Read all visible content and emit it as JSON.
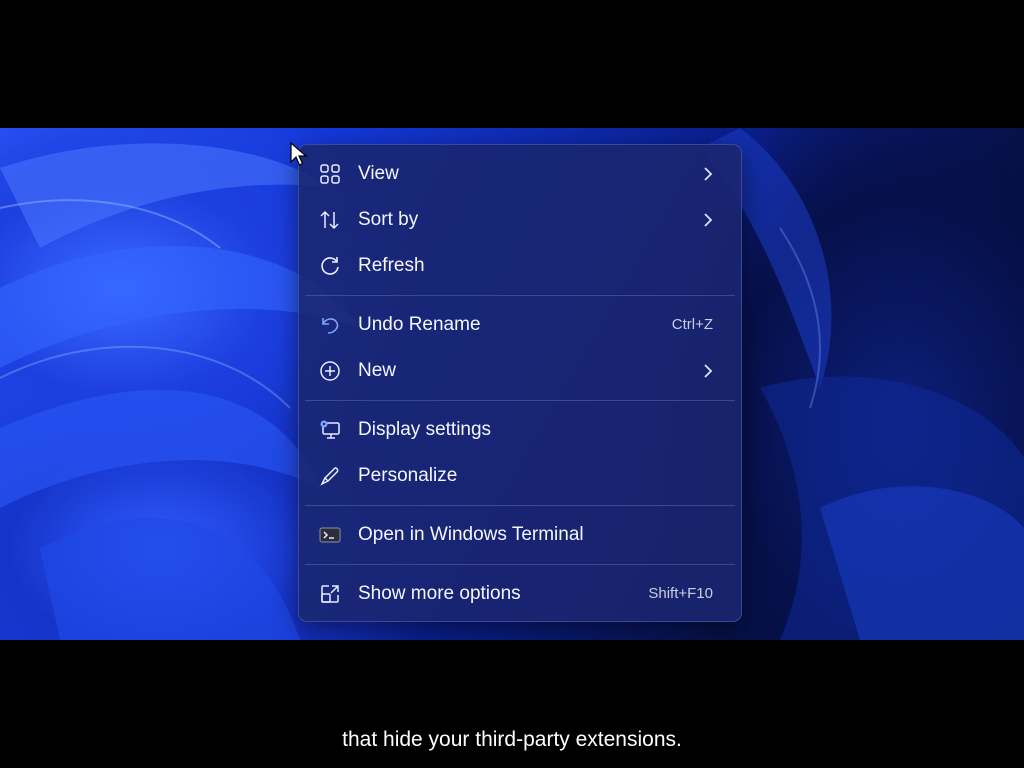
{
  "menu": {
    "items": [
      {
        "label": "View",
        "icon": "grid-icon",
        "submenu": true
      },
      {
        "label": "Sort by",
        "icon": "sort-arrows-icon",
        "submenu": true
      },
      {
        "label": "Refresh",
        "icon": "refresh-icon"
      },
      {
        "label": "Undo Rename",
        "icon": "undo-icon",
        "shortcut": "Ctrl+Z"
      },
      {
        "label": "New",
        "icon": "plus-circle-icon",
        "submenu": true
      },
      {
        "label": "Display settings",
        "icon": "display-settings-icon"
      },
      {
        "label": "Personalize",
        "icon": "brush-icon"
      },
      {
        "label": "Open in Windows Terminal",
        "icon": "terminal-icon"
      },
      {
        "label": "Show more options",
        "icon": "share-box-icon",
        "shortcut": "Shift+F10"
      }
    ]
  },
  "caption": {
    "text": "that hide your third-party extensions."
  },
  "colors": {
    "menu_bg": "#1a266e",
    "wallpaper_accent": "#2a55f5",
    "text": "#f4f6ff"
  }
}
